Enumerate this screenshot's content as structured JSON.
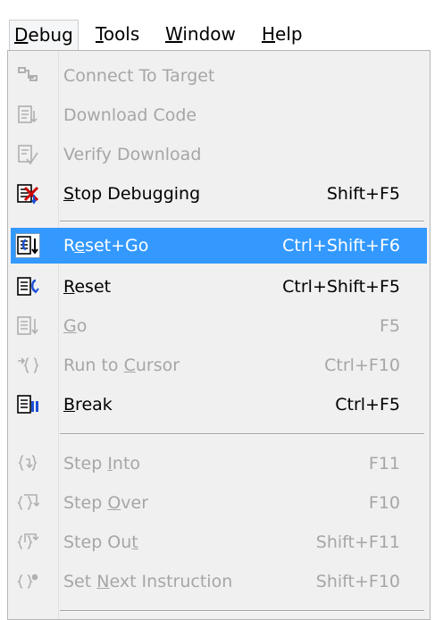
{
  "menubar": [
    {
      "prefix": "",
      "accel": "D",
      "rest": "ebug"
    },
    {
      "prefix": "",
      "accel": "T",
      "rest": "ools"
    },
    {
      "prefix": "",
      "accel": "W",
      "rest": "indow"
    },
    {
      "prefix": "",
      "accel": "H",
      "rest": "elp"
    }
  ],
  "menu": {
    "items": [
      {
        "pre": "Connect To Target",
        "acc": "",
        "post": "",
        "shortcut": "",
        "icon": "connect-icon",
        "enabled": false
      },
      {
        "pre": "Download Code",
        "acc": "",
        "post": "",
        "shortcut": "",
        "icon": "download-icon",
        "enabled": false
      },
      {
        "pre": "Verify Download",
        "acc": "",
        "post": "",
        "shortcut": "",
        "icon": "verify-icon",
        "enabled": false
      },
      {
        "pre": "",
        "acc": "S",
        "post": "top Debugging",
        "shortcut": "Shift+F5",
        "icon": "stop-debugging-icon",
        "enabled": true
      },
      {
        "pre": "R",
        "acc": "e",
        "post": "set+Go",
        "shortcut": "Ctrl+Shift+F6",
        "icon": "reset-go-icon",
        "enabled": true
      },
      {
        "pre": "",
        "acc": "R",
        "post": "eset",
        "shortcut": "Ctrl+Shift+F5",
        "icon": "reset-icon",
        "enabled": true
      },
      {
        "pre": "",
        "acc": "G",
        "post": "o",
        "shortcut": "F5",
        "icon": "go-icon",
        "enabled": false
      },
      {
        "pre": "Run to ",
        "acc": "C",
        "post": "ursor",
        "shortcut": "Ctrl+F10",
        "icon": "run-to-cursor-icon",
        "enabled": false
      },
      {
        "pre": "",
        "acc": "B",
        "post": "reak",
        "shortcut": "Ctrl+F5",
        "icon": "break-icon",
        "enabled": true
      },
      {
        "pre": "Step ",
        "acc": "I",
        "post": "nto",
        "shortcut": "F11",
        "icon": "step-into-icon",
        "enabled": false
      },
      {
        "pre": "Step ",
        "acc": "O",
        "post": "ver",
        "shortcut": "F10",
        "icon": "step-over-icon",
        "enabled": false
      },
      {
        "pre": "Step Ou",
        "acc": "t",
        "post": "",
        "shortcut": "Shift+F11",
        "icon": "step-out-icon",
        "enabled": false
      },
      {
        "pre": "Set ",
        "acc": "N",
        "post": "ext Instruction",
        "shortcut": "Shift+F10",
        "icon": "set-next-instruction-icon",
        "enabled": false
      }
    ],
    "highlighted_index": 4
  },
  "colors": {
    "highlight": "#3399ff",
    "disabled": "#a6a6a6",
    "menu_bg": "#f0f0f0"
  }
}
